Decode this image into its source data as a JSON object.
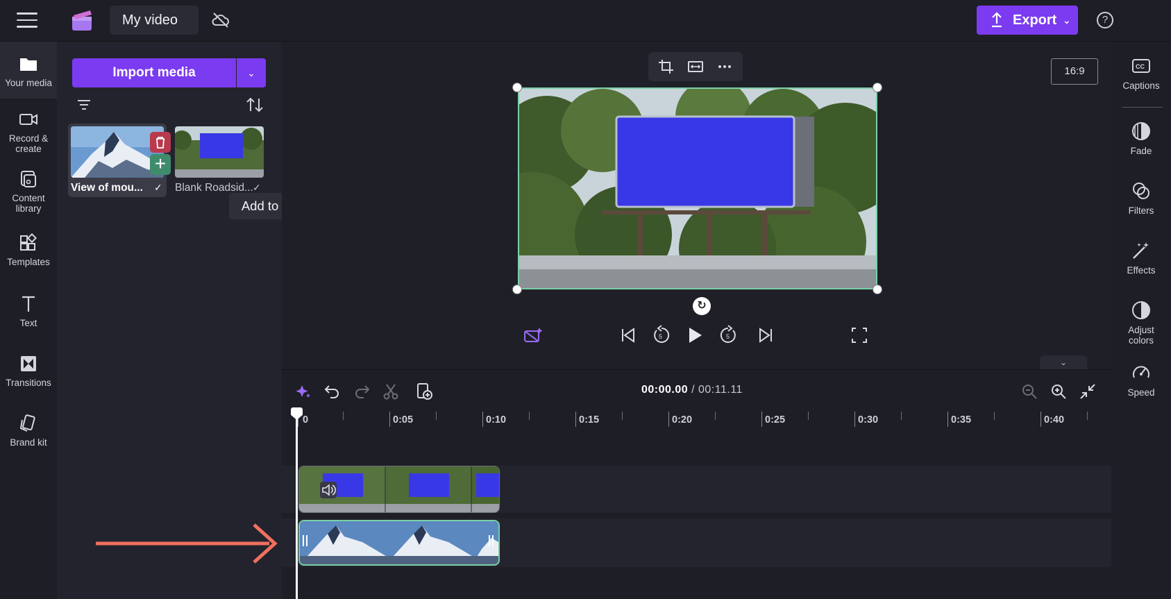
{
  "header": {
    "project_title": "My video",
    "export_label": "Export",
    "help_label": "?"
  },
  "left_nav": {
    "items": [
      {
        "label": "Your media",
        "icon": "folder-icon"
      },
      {
        "label": "Record & create",
        "icon": "video-camera-icon"
      },
      {
        "label": "Content library",
        "icon": "content-library-icon"
      },
      {
        "label": "Templates",
        "icon": "templates-icon"
      },
      {
        "label": "Text",
        "icon": "text-icon"
      },
      {
        "label": "Transitions",
        "icon": "transitions-icon"
      },
      {
        "label": "Brand kit",
        "icon": "brand-kit-icon"
      }
    ]
  },
  "media": {
    "import_label": "Import media",
    "items": [
      {
        "label": "View of mou...",
        "selected": true
      },
      {
        "label": "Blank Roadsid...",
        "selected": false
      }
    ],
    "tooltip": "Add to timeline"
  },
  "preview": {
    "aspect_ratio": "16:9"
  },
  "timeline": {
    "current_time": "00:00.00",
    "separator": " / ",
    "total_time": "00:11.11",
    "ruler_labels": [
      "0",
      "0:05",
      "0:10",
      "0:15",
      "0:20",
      "0:25",
      "0:30",
      "0:35",
      "0:40"
    ]
  },
  "right_nav": {
    "items": [
      {
        "label": "Captions",
        "icon": "captions-icon"
      },
      {
        "label": "Fade",
        "icon": "fade-icon"
      },
      {
        "label": "Filters",
        "icon": "filters-icon"
      },
      {
        "label": "Effects",
        "icon": "effects-icon"
      },
      {
        "label": "Adjust colors",
        "icon": "adjust-colors-icon"
      },
      {
        "label": "Speed",
        "icon": "speed-icon"
      }
    ]
  },
  "colors": {
    "accent": "#7b3bf0",
    "selection": "#7ad0a6",
    "annotation_arrow": "#f07060"
  }
}
